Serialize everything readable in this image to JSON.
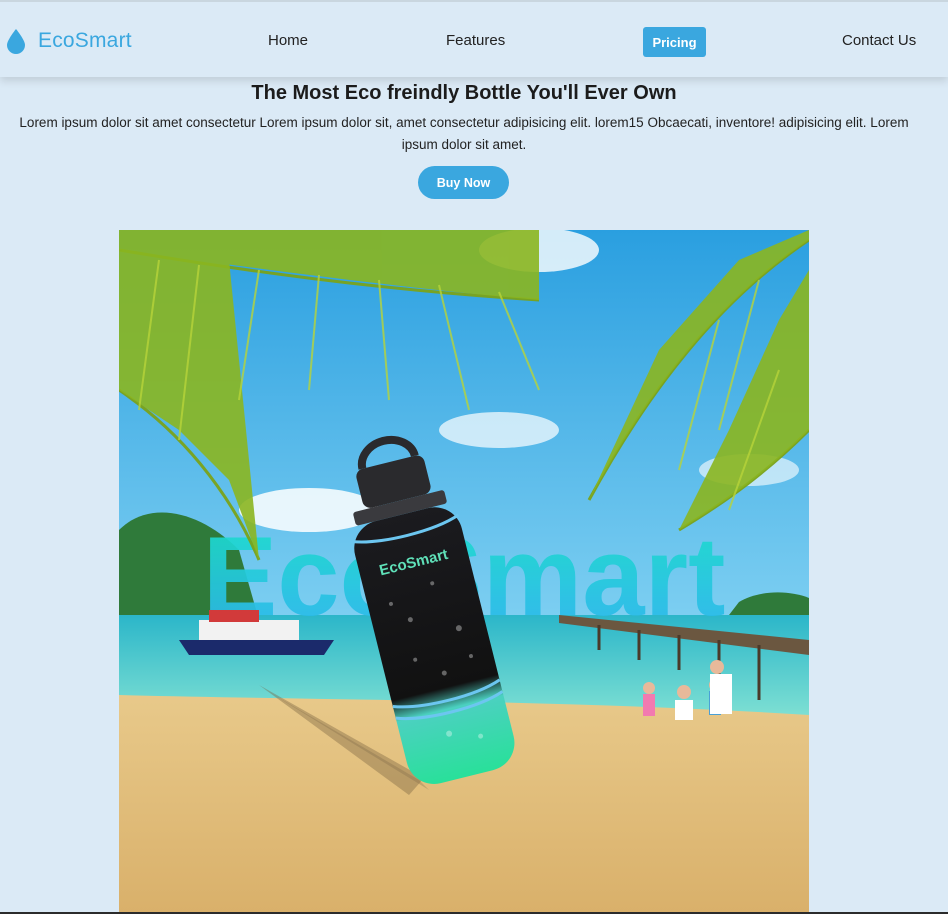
{
  "brand": {
    "name": "EcoSmart",
    "icon": "water-drop-icon",
    "color": "#3aa7df"
  },
  "nav": {
    "home": "Home",
    "features": "Features",
    "pricing": "Pricing",
    "contact": "Contact Us"
  },
  "hero": {
    "title": "The Most Eco freindly Bottle You'll Ever Own",
    "text": "Lorem ipsum dolor sit amet consectetur Lorem ipsum dolor sit, amet consectetur adipisicing elit. lorem15 Obcaecati, inventore! adipisicing elit. Lorem ipsum dolor sit amet.",
    "cta": "Buy Now"
  },
  "image": {
    "watermark": "EcoSmart",
    "bottle_label": "EcoSmart"
  },
  "colors": {
    "background": "#dbeaf6",
    "accent": "#3aa7df"
  }
}
